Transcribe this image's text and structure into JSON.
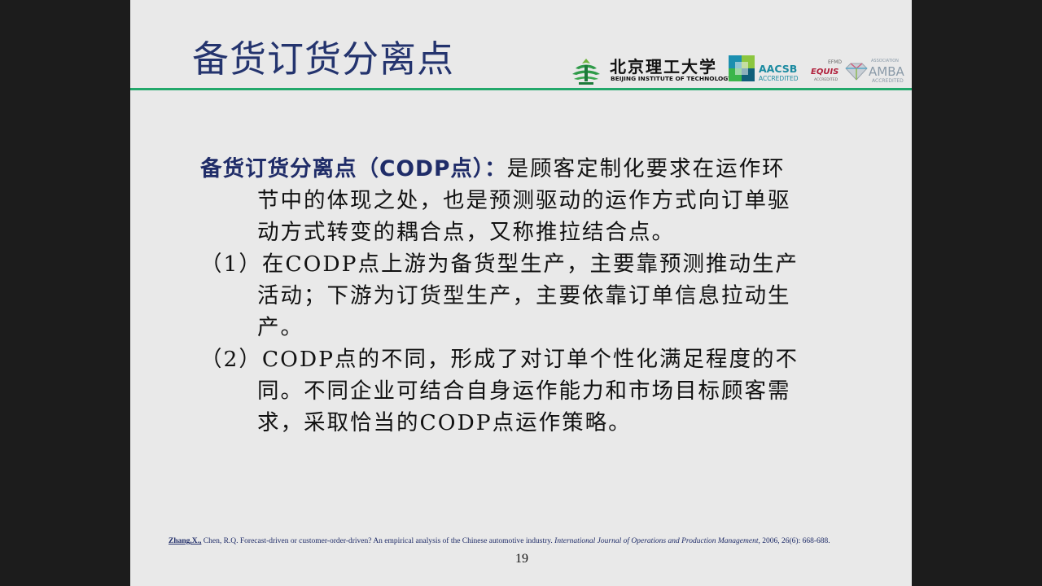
{
  "colors": {
    "background": "#1c1c1c",
    "slide": "#e9e9e9",
    "title": "#24346e",
    "rule": "#23a86b",
    "term": "#1f2c68"
  },
  "slide": {
    "title": "备货订货分离点",
    "logos": {
      "bit_name_cn": "北京理工大学",
      "bit_name_en": "BEIJING INSTITUTE OF TECHNOLOGY",
      "aacsb_name": "AACSB",
      "aacsb_sub": "ACCREDITED",
      "efmd_label": "EFMD",
      "equis_name": "EQUIS",
      "equis_sub": "ACCREDITED",
      "amba_top": "ASSOCIATION",
      "amba_name": "AMBA",
      "amba_sub": "ACCREDITED"
    },
    "definition": {
      "term": "备货订货分离点（CODP点）：",
      "text": "是顾客定制化要求在运作环\n节中的体现之处，也是预测驱动的运作方式向订单驱\n动方式转变的耦合点，又称推拉结合点。"
    },
    "points": [
      {
        "text": "（1）在CODP点上游为备货型生产，主要靠预测推动生产\n活动；下游为订货型生产，主要依靠订单信息拉动生\n产。"
      },
      {
        "text": "（2）CODP点的不同，形成了对订单个性化满足程度的不\n同。不同企业可结合自身运作能力和市场目标顾客需\n求，采取恰当的CODP点运作策略。"
      }
    ],
    "reference": {
      "author": "Zhang,X.,",
      "text": " Chen, R.Q. Forecast-driven or customer-order-driven? An empirical analysis of the Chinese automotive industry. ",
      "journal": "International Journal of Operations and Production Management",
      "details": ", 2006, 26(6): 668-688."
    },
    "page_number": "19"
  }
}
